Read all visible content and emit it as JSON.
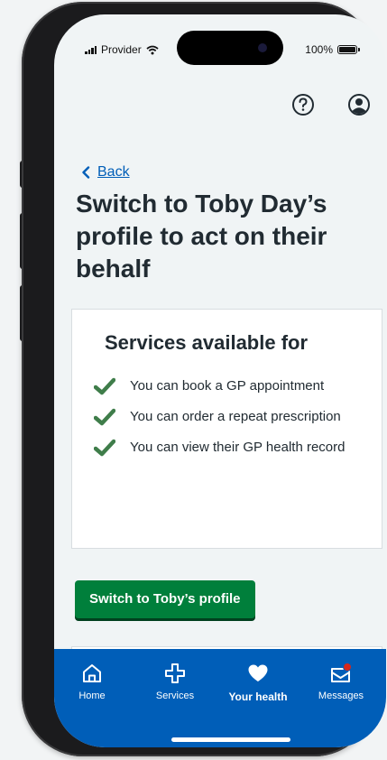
{
  "status_bar": {
    "carrier": "Provider",
    "battery": "100%"
  },
  "header": {
    "help_icon": "help-circle-icon",
    "account_icon": "account-circle-icon"
  },
  "back": {
    "label": "Back"
  },
  "page": {
    "title": "Switch to Toby Day’s profile to act on their behalf"
  },
  "services": {
    "heading": "Services available for",
    "items": [
      {
        "label": "You can book a GP appointment"
      },
      {
        "label": "You can order a repeat prescription"
      },
      {
        "label": "You can view their GP health record"
      }
    ]
  },
  "actions": {
    "switch_label": "Switch to Toby’s profile"
  },
  "nav": {
    "items": [
      {
        "label": "Home",
        "icon": "home-icon"
      },
      {
        "label": "Services",
        "icon": "cross-icon"
      },
      {
        "label": "Your health",
        "icon": "heart-icon",
        "active": true
      },
      {
        "label": "Messages",
        "icon": "envelope-icon"
      }
    ]
  },
  "colors": {
    "primary_blue": "#005eb8",
    "button_green": "#007f3b",
    "tick_green": "#3f7d4a",
    "text_dark": "#212b32",
    "notification_red": "#d5281b"
  }
}
